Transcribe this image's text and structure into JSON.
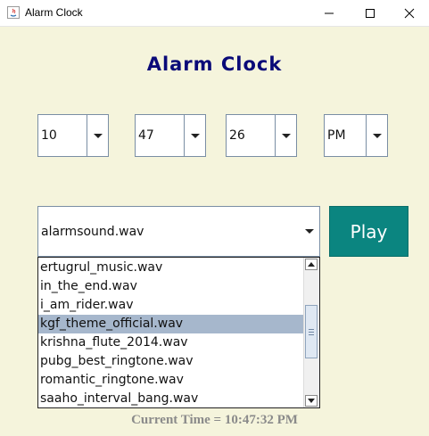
{
  "window": {
    "title": "Alarm Clock",
    "icons": [
      "java-icon",
      "minimize-icon",
      "maximize-icon",
      "close-icon"
    ]
  },
  "heading": "Alarm Clock",
  "time_selectors": {
    "hour": "10",
    "minute": "47",
    "second": "26",
    "ampm": "PM"
  },
  "sound": {
    "selected": "alarmsound.wav",
    "options": [
      "ertugrul_music.wav",
      "in_the_end.wav",
      "i_am_rider.wav",
      "kgf_theme_official.wav",
      "krishna_flute_2014.wav",
      "pubg_best_ringtone.wav",
      "romantic_ringtone.wav",
      "saaho_interval_bang.wav"
    ],
    "highlighted": "kgf_theme_official.wav"
  },
  "play_label": "Play",
  "current_time": "Current Time = 10:47:32 PM",
  "colors": {
    "background": "#f5f4dc",
    "heading": "#0a0a78",
    "play_button": "#0b8580",
    "selection": "#a6b7cc"
  }
}
